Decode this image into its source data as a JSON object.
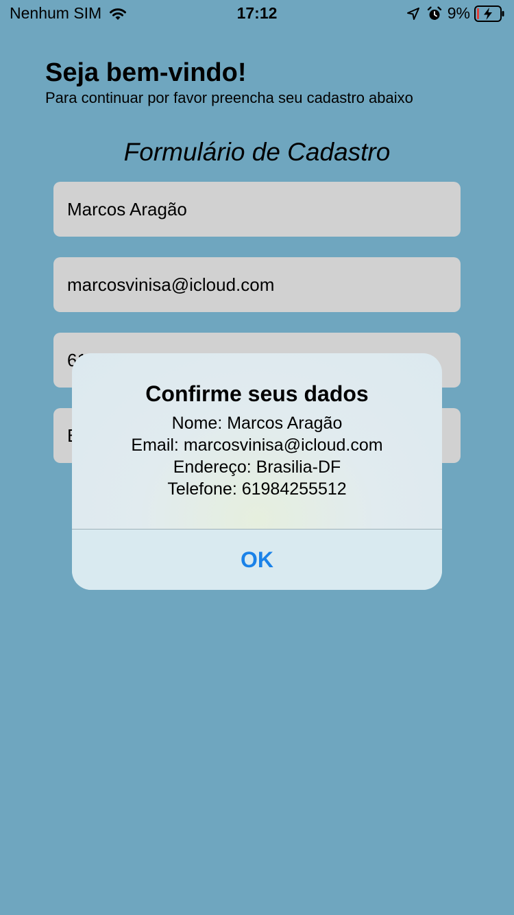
{
  "status_bar": {
    "carrier": "Nenhum SIM",
    "time": "17:12",
    "battery_percent": "9%",
    "icons": [
      "wifi-icon",
      "location-arrow-icon",
      "alarm-icon",
      "battery-charging-icon"
    ]
  },
  "header": {
    "welcome": "Seja bem-vindo!",
    "subtitle": "Para continuar por favor preencha seu cadastro abaixo"
  },
  "form": {
    "title": "Formulário de Cadastro",
    "name_value": "Marcos Aragão",
    "email_value": "marcosvinisa@icloud.com",
    "phone_value": "61",
    "address_value": "B"
  },
  "alert": {
    "title": "Confirme seus dados",
    "lines": [
      "Nome: Marcos Aragão",
      "Email: marcosvinisa@icloud.com",
      "Endereço: Brasilia-DF",
      "Telefone: 61984255512"
    ],
    "ok_label": "OK"
  },
  "colors": {
    "background": "#6fa6bf",
    "field": "#d1d1d1",
    "alert_button": "#1a82e8",
    "battery_low": "#e0403a"
  }
}
